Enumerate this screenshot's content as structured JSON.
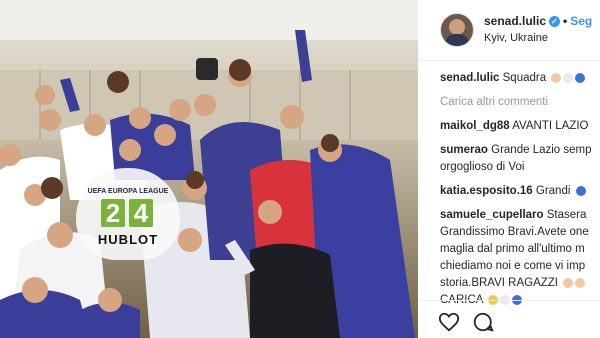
{
  "post": {
    "username": "senad.lulic",
    "follow_label": "Seg",
    "location": "Kyiv, Ukraine"
  },
  "photo": {
    "banner_text": "UEFA EUROPA LEAGUE",
    "score_home": "2",
    "score_away": "4",
    "sponsor": "HUBLOT"
  },
  "caption": {
    "user": "senad.lulic",
    "text": "Squadra"
  },
  "load_more": "Carica altri commenti",
  "comments": [
    {
      "user": "maikol_dg88",
      "text": "AVANTI LAZIO"
    },
    {
      "user": "sumerao",
      "text": "Grande Lazio semp"
    },
    {
      "user": "",
      "text": "orgoglioso di Voi"
    },
    {
      "user": "katia.esposito.16",
      "text": "Grandi"
    },
    {
      "user": "samuele_cupellaro",
      "text": "Stasera"
    },
    {
      "user": "",
      "text": "Grandissimo Bravi.Avete one"
    },
    {
      "user": "",
      "text": "maglia dal primo all'ultimo m"
    },
    {
      "user": "",
      "text": "chiediamo noi e come vi imp"
    },
    {
      "user": "",
      "text": "storia.BRAVI RAGAZZI"
    },
    {
      "user": "",
      "text": "CARICA"
    }
  ],
  "icons": {
    "like": "heart-icon",
    "comment": "comment-bubble-icon",
    "verified": "verified-badge-icon"
  },
  "colors": {
    "link_blue": "#3897f0",
    "photo_purple": "#3b3f9e",
    "text_dark": "#262626"
  }
}
